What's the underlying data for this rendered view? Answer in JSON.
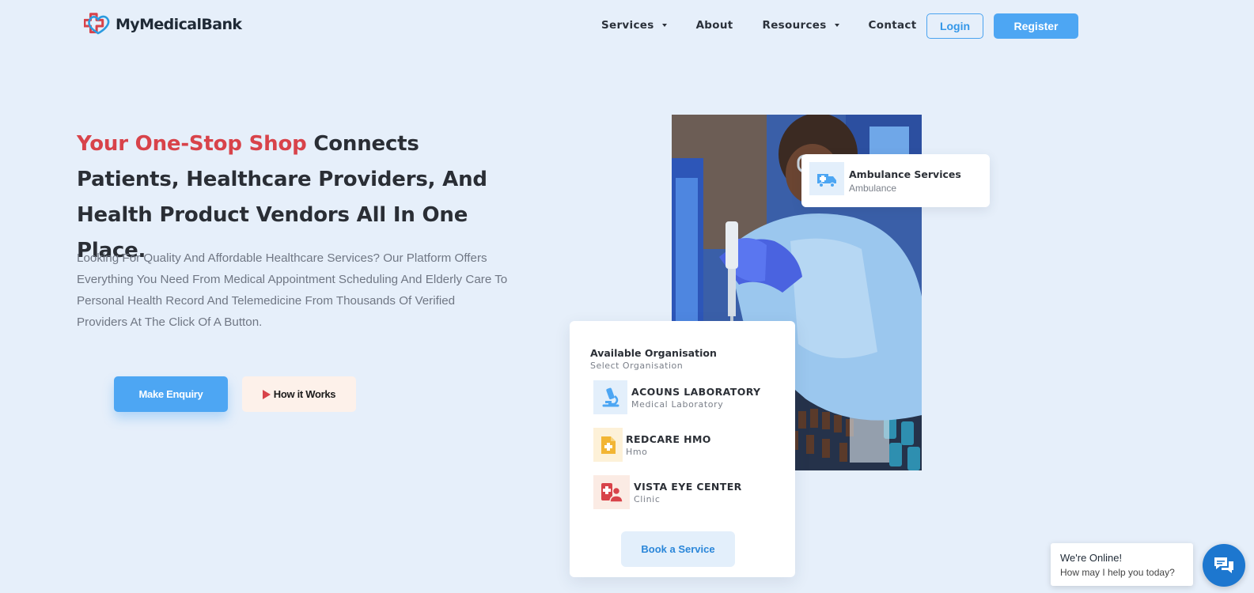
{
  "header": {
    "logo_text": "MyMedicalBank",
    "nav": [
      {
        "label": "Services",
        "dropdown": true
      },
      {
        "label": "About",
        "dropdown": false
      },
      {
        "label": "Resources",
        "dropdown": true
      },
      {
        "label": "Contact",
        "dropdown": false
      }
    ],
    "login_label": "Login",
    "register_label": "Register"
  },
  "hero": {
    "title_accent": "Your One-Stop Shop",
    "title_rest": " Connects Patients, Healthcare Providers, And Health Product Vendors All In One Place.",
    "description": "Looking For Quality And Affordable Healthcare Services? Our Platform Offers Everything You Need From Medical Appointment Scheduling And Elderly Care To Personal Health Record And Telemedicine From Thousands Of Verified Providers At The Click Of A Button.",
    "enquiry_label": "Make Enquiry",
    "how_label": "How it Works"
  },
  "ambulance_card": {
    "title": "Ambulance Services",
    "subtitle": "Ambulance",
    "icon": "ambulance-icon"
  },
  "org_card": {
    "title": "Available Organisation",
    "subtitle": "Select Organisation",
    "items": [
      {
        "name": "ACOUNS LABORATORY",
        "type": "Medical Laboratory",
        "icon": "microscope-icon",
        "icon_color": "#4da6f3",
        "bg": "#e3effb"
      },
      {
        "name": "REDCARE HMO",
        "type": "Hmo",
        "icon": "medical-document-icon",
        "icon_color": "#f2b534",
        "bg": "#fdf1d8"
      },
      {
        "name": "VISTA EYE CENTER",
        "type": "Clinic",
        "icon": "doctor-icon",
        "icon_color": "#d8434a",
        "bg": "#fbebe4"
      }
    ],
    "book_label": "Book a Service"
  },
  "chat": {
    "title": "We're Online!",
    "subtitle": "How may I help you today?",
    "icon": "chat-icon"
  },
  "colors": {
    "background": "#e6effa",
    "accent_blue": "#4da6f3",
    "accent_red": "#d8434a"
  }
}
